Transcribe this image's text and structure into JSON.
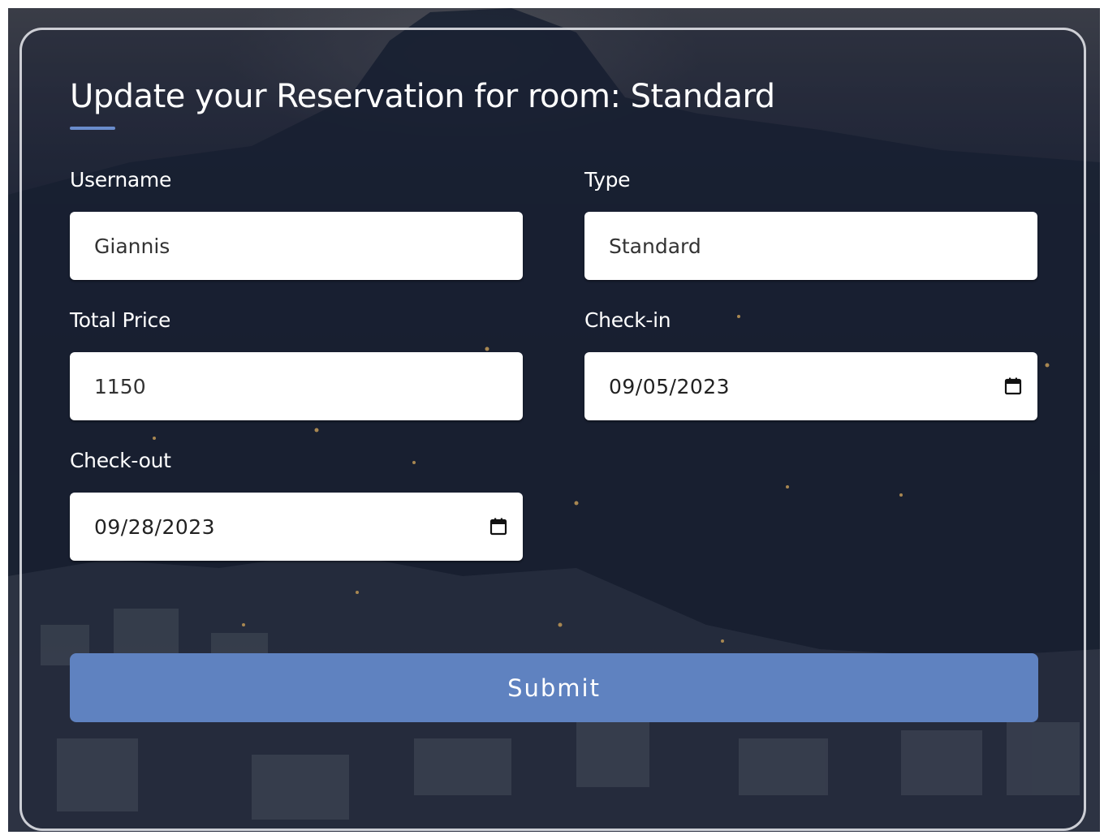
{
  "form": {
    "title": "Update your Reservation for room: Standard",
    "username": {
      "label": "Username",
      "value": "Giannis"
    },
    "type": {
      "label": "Type",
      "value": "Standard"
    },
    "total_price": {
      "label": "Total Price",
      "value": "1150"
    },
    "check_in": {
      "label": "Check-in",
      "value": "09/05/2023",
      "icon": "calendar-icon"
    },
    "check_out": {
      "label": "Check-out",
      "value": "09/28/2023",
      "icon": "calendar-icon"
    },
    "submit_label": "Submit"
  },
  "colors": {
    "accent": "#6a8ccc",
    "submit_button": "#5f82c0",
    "field_background": "#ffffff",
    "label_text": "#ffffff"
  }
}
